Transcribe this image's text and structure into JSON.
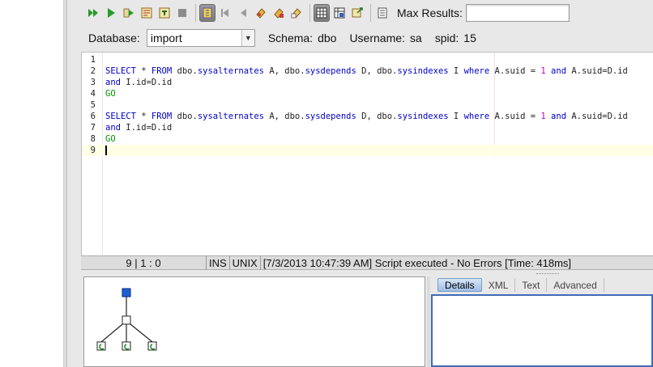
{
  "toolbar": {
    "icons": [
      "run-all-icon",
      "run-icon",
      "run-step-icon",
      "explain-icon",
      "plan-icon",
      "stop-icon",
      "format-icon",
      "back-icon",
      "forward-icon",
      "bookmark-icon",
      "bookmark-next-icon",
      "bookmark-prev-icon",
      "grid-view-icon",
      "plan-view-icon",
      "export-icon",
      "history-icon"
    ],
    "max_results_label": "Max Results:",
    "max_results_value": ""
  },
  "connection": {
    "database_label": "Database:",
    "database_value": "import",
    "schema_label": "Schema:",
    "schema_value": "dbo",
    "username_label": "Username:",
    "username_value": "sa",
    "spid_label": "spid:",
    "spid_value": "15"
  },
  "editor": {
    "lines": [
      {
        "n": "1",
        "segments": []
      },
      {
        "n": "2",
        "segments": [
          {
            "t": "kw",
            "v": "SELECT"
          },
          {
            "t": "tx",
            "v": " * "
          },
          {
            "t": "kw",
            "v": "FROM"
          },
          {
            "t": "tx",
            "v": " dbo."
          },
          {
            "t": "kw",
            "v": "sysalternates"
          },
          {
            "t": "tx",
            "v": " A, dbo."
          },
          {
            "t": "kw",
            "v": "sysdepends"
          },
          {
            "t": "tx",
            "v": " D, dbo."
          },
          {
            "t": "kw",
            "v": "sysindexes"
          },
          {
            "t": "tx",
            "v": " I "
          },
          {
            "t": "kw",
            "v": "where"
          },
          {
            "t": "tx",
            "v": " A.suid = "
          },
          {
            "t": "num",
            "v": "1"
          },
          {
            "t": "tx",
            "v": " "
          },
          {
            "t": "kw",
            "v": "and"
          },
          {
            "t": "tx",
            "v": " A.suid=D.id"
          }
        ]
      },
      {
        "n": "3",
        "segments": [
          {
            "t": "kw",
            "v": "and"
          },
          {
            "t": "tx",
            "v": " I.id=D.id"
          }
        ]
      },
      {
        "n": "4",
        "segments": [
          {
            "t": "go",
            "v": "GO"
          }
        ]
      },
      {
        "n": "5",
        "segments": []
      },
      {
        "n": "6",
        "segments": [
          {
            "t": "kw",
            "v": "SELECT"
          },
          {
            "t": "tx",
            "v": " * "
          },
          {
            "t": "kw",
            "v": "FROM"
          },
          {
            "t": "tx",
            "v": " dbo."
          },
          {
            "t": "kw",
            "v": "sysalternates"
          },
          {
            "t": "tx",
            "v": " A, dbo."
          },
          {
            "t": "kw",
            "v": "sysdepends"
          },
          {
            "t": "tx",
            "v": " D, dbo."
          },
          {
            "t": "kw",
            "v": "sysindexes"
          },
          {
            "t": "tx",
            "v": " I "
          },
          {
            "t": "kw",
            "v": "where"
          },
          {
            "t": "tx",
            "v": " A.suid = "
          },
          {
            "t": "num",
            "v": "1"
          },
          {
            "t": "tx",
            "v": " "
          },
          {
            "t": "kw",
            "v": "and"
          },
          {
            "t": "tx",
            "v": " A.suid=D.id"
          }
        ]
      },
      {
        "n": "7",
        "segments": [
          {
            "t": "kw",
            "v": "and"
          },
          {
            "t": "tx",
            "v": " I.id=D.id"
          }
        ]
      },
      {
        "n": "8",
        "segments": [
          {
            "t": "go",
            "v": "GO"
          }
        ]
      },
      {
        "n": "9",
        "segments": []
      }
    ],
    "current_line": 9
  },
  "status": {
    "position": "9 | 1 : 0",
    "mode": "INS",
    "line_ending": "UNIX",
    "message": "[7/3/2013 10:47:39 AM] Script executed - No Errors [Time: 418ms]"
  },
  "results": {
    "tabs": [
      "Details",
      "XML",
      "Text",
      "Advanced"
    ],
    "active_tab": "Details"
  },
  "colors": {
    "keyword": "#0000c8",
    "go": "#009600",
    "number": "#c800c8",
    "plan_root": "#1f5fd6",
    "details_border": "#3f6bb5"
  }
}
